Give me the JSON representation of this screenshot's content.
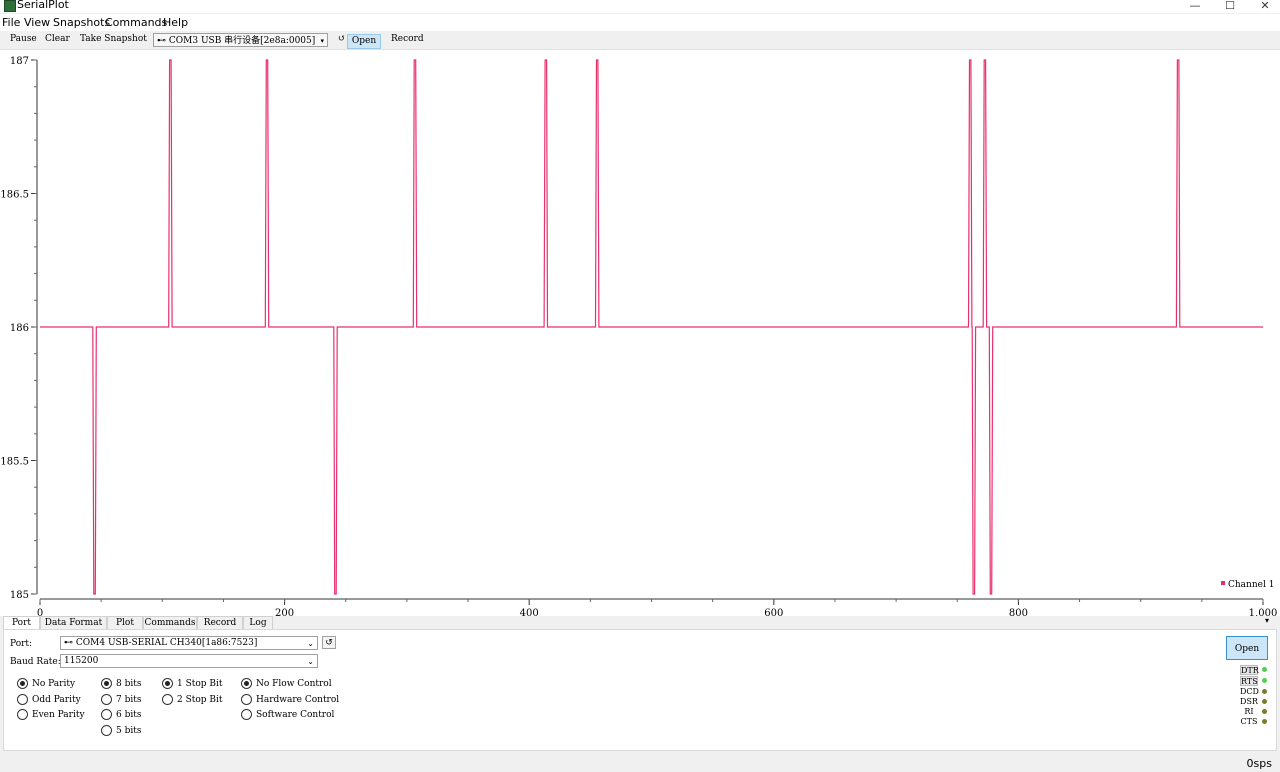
{
  "window": {
    "title": "SerialPlot",
    "minimize": "—",
    "maximize": "☐",
    "close": "✕"
  },
  "menu": [
    "File",
    "View",
    "Snapshots",
    "Commands",
    "Help"
  ],
  "toolbar": {
    "pause": "Pause",
    "clear": "Clear",
    "snapshot": "Take Snapshot",
    "port": "COM3 USB 串行设备[2e8a:0005]",
    "open": "Open",
    "record": "Record"
  },
  "chart_data": {
    "type": "line",
    "xlim": [
      0,
      1000
    ],
    "ylim": [
      185,
      187
    ],
    "x_ticks": [
      "0",
      "200",
      "400",
      "600",
      "800",
      "1,000"
    ],
    "x_tick_values": [
      0,
      200,
      400,
      600,
      800,
      1000
    ],
    "y_ticks": [
      "185",
      "185.5",
      "186",
      "186.5",
      "187"
    ],
    "y_tick_values": [
      185,
      185.5,
      186,
      186.5,
      187
    ],
    "grid": false,
    "legend_position": "bottom-right",
    "series": [
      {
        "name": "Channel 1",
        "color": "#e8306b",
        "baseline": 186,
        "spikes": [
          {
            "x": 44,
            "y": 185
          },
          {
            "x": 106,
            "y": 187
          },
          {
            "x": 185,
            "y": 187
          },
          {
            "x": 241,
            "y": 185
          },
          {
            "x": 306,
            "y": 187
          },
          {
            "x": 413,
            "y": 187
          },
          {
            "x": 455,
            "y": 187
          },
          {
            "x": 760,
            "y": 187
          },
          {
            "x": 763,
            "y": 185
          },
          {
            "x": 772,
            "y": 187
          },
          {
            "x": 777,
            "y": 185
          },
          {
            "x": 930,
            "y": 187
          }
        ]
      }
    ]
  },
  "tabs": [
    "Port",
    "Data Format",
    "Plot",
    "Commands",
    "Record",
    "Log"
  ],
  "port_panel": {
    "port_label": "Port:",
    "port_value": "COM4 USB-SERIAL CH340[1a86:7523]",
    "baud_label": "Baud Rate:",
    "baud_value": "115200",
    "parity": [
      "No Parity",
      "Odd Parity",
      "Even Parity"
    ],
    "data_bits": [
      "8 bits",
      "7 bits",
      "6 bits",
      "5 bits"
    ],
    "stop_bits": [
      "1 Stop Bit",
      "2 Stop Bit"
    ],
    "flow": [
      "No Flow Control",
      "Hardware Control",
      "Software Control"
    ],
    "open": "Open",
    "signals": [
      "DTR",
      "RTS",
      "DCD",
      "DSR",
      "RI",
      "CTS"
    ]
  },
  "colors": {
    "led_on": "#4fd14f",
    "led_off": "#7a7a2a",
    "line": "#e8306b"
  },
  "status": {
    "sps": "0sps"
  }
}
